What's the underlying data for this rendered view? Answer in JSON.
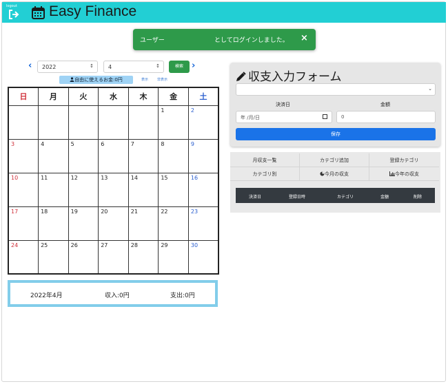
{
  "header": {
    "logout_label": "logout",
    "title": "Easy Finance",
    "brand_color": "#22cfd4"
  },
  "toast": {
    "user": "ユーザー",
    "message": "としてログインしました。",
    "close": "×",
    "color": "#2e9a4a"
  },
  "controls": {
    "prev": "‹",
    "next": "›",
    "year": "2022",
    "month": "4",
    "search_label": "検索",
    "free_money": "自由に使えるお金:0円",
    "show_link": "表示",
    "hide_link": "非表示"
  },
  "calendar": {
    "weekdays": [
      "日",
      "月",
      "火",
      "水",
      "木",
      "金",
      "土"
    ],
    "weeks": [
      [
        "",
        "",
        "",
        "",
        "",
        "1",
        "2"
      ],
      [
        "3",
        "4",
        "5",
        "6",
        "7",
        "8",
        "9"
      ],
      [
        "10",
        "11",
        "12",
        "13",
        "14",
        "15",
        "16"
      ],
      [
        "17",
        "18",
        "19",
        "20",
        "21",
        "22",
        "23"
      ],
      [
        "24",
        "25",
        "26",
        "27",
        "28",
        "29",
        "30"
      ]
    ]
  },
  "summary": {
    "month": "2022年4月",
    "income": "収入:0円",
    "expense": "支出:0円"
  },
  "form": {
    "title": "収支入力フォーム",
    "date_label": "決済日",
    "amount_label": "金額",
    "date_placeholder": "年 /月/日",
    "amount_value": "0",
    "save_label": "保存"
  },
  "tabs": [
    "月収支一覧",
    "カテゴリ追加",
    "登録カテゴリ",
    "カテゴリ別",
    "今月の収支",
    "今年の収支"
  ],
  "table_headers": [
    "決済日",
    "登録日時",
    "カテゴリ",
    "金額",
    "削除"
  ],
  "icons": [
    "logout-icon",
    "calendar-icon",
    "pencil-icon",
    "user-icon",
    "pie-chart-icon",
    "bar-chart-icon"
  ]
}
